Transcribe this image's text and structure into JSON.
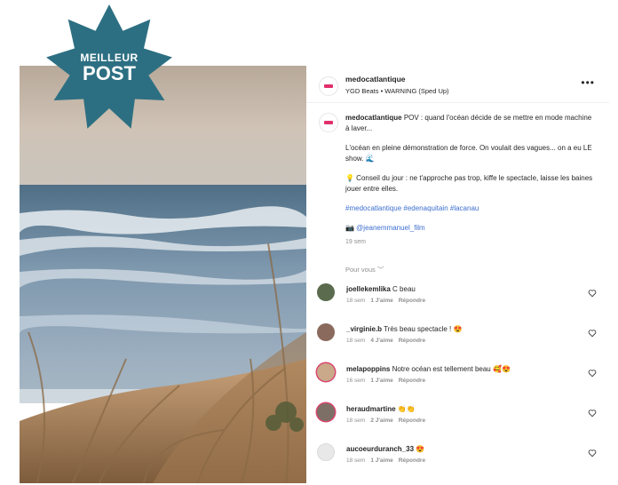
{
  "badge": {
    "line1": "MEILLEUR",
    "line2": "POST"
  },
  "header": {
    "username": "medocatlantique",
    "music": "YGD Beats • WARNING (Sped Up)",
    "more": "•••"
  },
  "caption": {
    "username": "medocatlantique",
    "intro": "POV : quand l'océan décide de se mettre en mode machine à laver...",
    "paragraph2": "L'océan en pleine démonstration de force. On voulait des vagues... on a eu LE show. 🌊",
    "paragraph3": "💡 Conseil du jour : ne t'approche pas trop, kiffe le spectacle, laisse les baines jouer entre elles.",
    "hashtags": "#medocatlantique #edenaquitain #lacanau",
    "credit": "📷 @jeanemmanuel_film",
    "time": "19 sem"
  },
  "section": {
    "for_you": "Pour vous ﹀"
  },
  "comments": [
    {
      "user": "joellekemlika",
      "text": "C beau",
      "time": "18 sem",
      "likes": "1 J'aime",
      "reply": "Répondre",
      "avatar_color": "#5a6b4e"
    },
    {
      "user": "_virginie.b",
      "text": "Très beau spectacle ! 😍",
      "time": "18 sem",
      "likes": "4 J'aime",
      "reply": "Répondre",
      "avatar_color": "#8a6a5c"
    },
    {
      "user": "melapoppins",
      "text": "Notre océan est tellement beau 🥰😍",
      "time": "16 sem",
      "likes": "1 J'aime",
      "reply": "Répondre",
      "avatar_color": "#c9a98a"
    },
    {
      "user": "heraudmartine",
      "text": "👏👏",
      "time": "18 sem",
      "likes": "2 J'aime",
      "reply": "Répondre",
      "avatar_color": "#7d6f66"
    },
    {
      "user": "aucoeurduranch_33",
      "text": "😍",
      "time": "18 sem",
      "likes": "1 J'aime",
      "reply": "Répondre",
      "avatar_color": "#e8e8e8"
    }
  ],
  "colors": {
    "badge": "#2d6f82",
    "link": "#3d6fcf",
    "brand": "#e0306b"
  }
}
